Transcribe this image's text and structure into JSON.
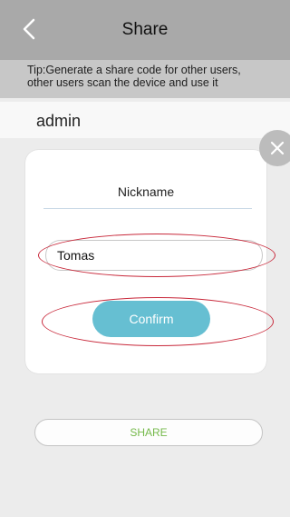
{
  "header": {
    "back_icon": "chevron-left-icon",
    "title": "Share"
  },
  "tip": {
    "line1": "Tip:Generate a share code for other users,",
    "line2": "other users scan the device and use it"
  },
  "account": {
    "name": "admin"
  },
  "dialog": {
    "close_icon": "close-icon",
    "nickname_label": "Nickname",
    "nickname_value": "Tomas",
    "confirm_label": "Confirm"
  },
  "share": {
    "label": "SHARE"
  },
  "colors": {
    "header_bg": "#a9a9a9",
    "tip_bg": "#c7c7c7",
    "confirm_bg": "#66bfd2",
    "share_text": "#75b94a",
    "highlight_oval": "#c8283a"
  }
}
